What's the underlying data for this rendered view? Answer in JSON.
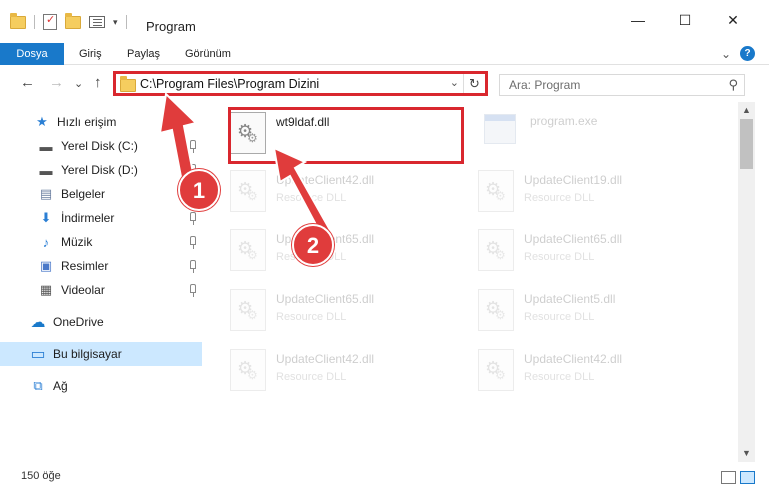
{
  "window": {
    "title": "Program",
    "controls": {
      "minimize": "—",
      "maximize": "☐",
      "close": "✕"
    }
  },
  "ribbon": {
    "tabs": [
      "Dosya",
      "Giriş",
      "Paylaş",
      "Görünüm"
    ],
    "expand_glyph": "⌄",
    "help_glyph": "?"
  },
  "nav": {
    "back": "←",
    "forward": "→",
    "recent": "⌄",
    "up": "↑"
  },
  "address": {
    "path": "C:\\Program Files\\Program Dizini",
    "dropdown": "⌄",
    "refresh": "↻"
  },
  "search": {
    "placeholder": "Ara: Program",
    "icon": "⚲"
  },
  "sidebar": {
    "items": [
      {
        "label": "Hızlı erişim",
        "icon": "star-icon",
        "glyph": "★",
        "color": "#2b7fd4"
      },
      {
        "label": "Yerel Disk (C:)",
        "icon": "drive-icon",
        "glyph": "▬",
        "color": "#555555",
        "pinned": true
      },
      {
        "label": "Yerel Disk (D:)",
        "icon": "drive-icon",
        "glyph": "▬",
        "color": "#555555",
        "pinned": true
      },
      {
        "label": "Belgeler",
        "icon": "documents-icon",
        "glyph": "▤",
        "color": "#6b7fa0",
        "pinned": true
      },
      {
        "label": "İndirmeler",
        "icon": "downloads-icon",
        "glyph": "⬇",
        "color": "#2b7fd4",
        "pinned": true
      },
      {
        "label": "Müzik",
        "icon": "music-icon",
        "glyph": "♪",
        "color": "#2b7fd4",
        "pinned": true
      },
      {
        "label": "Resimler",
        "icon": "pictures-icon",
        "glyph": "▣",
        "color": "#4a79c9",
        "pinned": true
      },
      {
        "label": "Videolar",
        "icon": "videos-icon",
        "glyph": "▦",
        "color": "#555555",
        "pinned": true
      },
      {
        "label": "OneDrive",
        "icon": "cloud-icon",
        "glyph": "☁",
        "color": "#1979ca"
      },
      {
        "label": "Bu bilgisayar",
        "icon": "computer-icon",
        "glyph": "▭",
        "color": "#2b7fd4",
        "selected": true
      },
      {
        "label": "Ağ",
        "icon": "network-icon",
        "glyph": "⧉",
        "color": "#2b7fd4"
      }
    ]
  },
  "files": {
    "highlighted": {
      "name": "wt9ldaf.dll"
    },
    "exe": {
      "name": "program.exe"
    },
    "grid": [
      {
        "name": "UpdateClient42.dll",
        "type": "Resource DLL"
      },
      {
        "name": "UpdateClient19.dll",
        "type": "Resource DLL"
      },
      {
        "name": "UpdateClient65.dll",
        "type": "Resource DLL"
      },
      {
        "name": "UpdateClient65.dll",
        "type": "Resource DLL"
      },
      {
        "name": "UpdateClient65.dll",
        "type": "Resource DLL"
      },
      {
        "name": "UpdateClient5.dll",
        "type": "Resource DLL"
      },
      {
        "name": "UpdateClient42.dll",
        "type": "Resource DLL"
      },
      {
        "name": "UpdateClient42.dll",
        "type": "Resource DLL"
      }
    ]
  },
  "annotations": {
    "step1": "1",
    "step2": "2",
    "accent": "#d9272e"
  },
  "status": {
    "count": "150 öğe"
  },
  "colors": {
    "accent": "#1979ca",
    "selection": "#cce8ff"
  }
}
